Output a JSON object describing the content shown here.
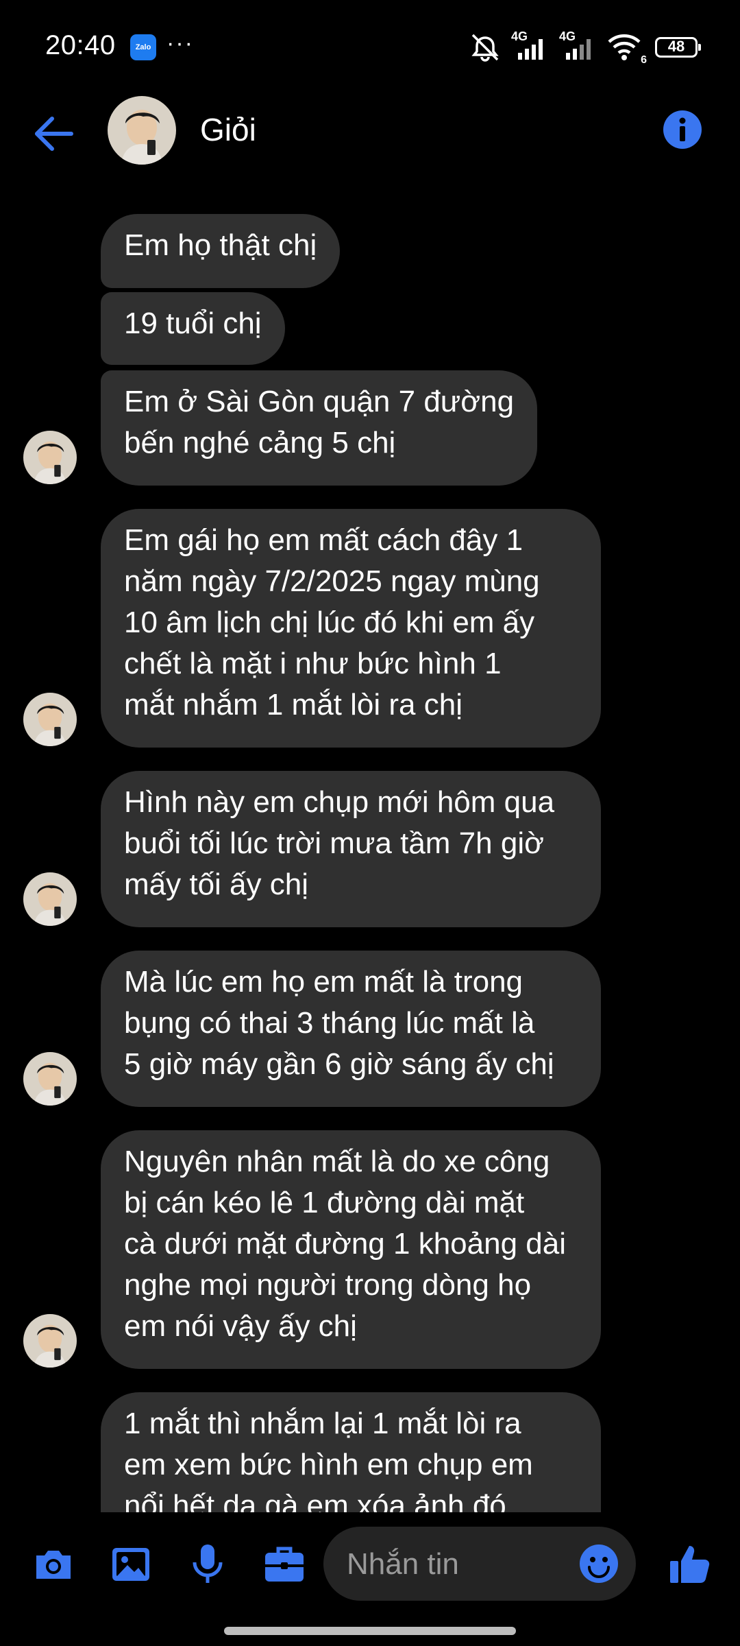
{
  "status_bar": {
    "time": "20:40",
    "zalo_label": "Zalo",
    "network_1": "4G",
    "network_2": "4G",
    "wifi_sub": "6",
    "battery": "48"
  },
  "header": {
    "contact_name": "Giỏi"
  },
  "messages": [
    {
      "lines": [
        "Em họ thật chị"
      ]
    },
    {
      "lines": [
        "19 tuổi chị"
      ]
    },
    {
      "lines": [
        "Em ở Sài Gòn quận 7 đường",
        "bến nghé cảng 5 chị"
      ]
    },
    {
      "lines": [
        "Em gái họ em mất cách đây 1",
        "năm ngày 7/2/2025 ngay mùng",
        "10 âm lịch chị lúc đó khi em ấy",
        "chết là mặt i như bức hình 1",
        "mắt nhắm 1 mắt lòi ra chị"
      ]
    },
    {
      "lines": [
        "Hình này em chụp mới hôm qua",
        "buổi tối lúc trời mưa tầm 7h giờ",
        "mấy tối ấy chị"
      ]
    },
    {
      "lines": [
        "Mà lúc em họ em mất là trong",
        "bụng có thai 3 tháng lúc mất là",
        "5 giờ máy gần 6 giờ sáng ấy chị"
      ]
    },
    {
      "lines": [
        "Nguyên nhân mất là do xe công",
        "bị cán kéo lê 1 đường dài mặt",
        "cà dưới mặt đường 1 khoảng dài",
        "nghe mọi người trong dòng họ",
        "em nói vậy ấy chị"
      ]
    },
    {
      "lines": [
        "1 mắt thì nhắm lại 1 mắt lòi ra",
        "em xem bức hình em chụp em",
        "nổi hết da gà em xóa ảnh đó"
      ]
    }
  ],
  "composer": {
    "placeholder": "Nhắn tin"
  },
  "colors": {
    "accent": "#3a76f0",
    "bubble": "#303030",
    "background": "#000000"
  }
}
